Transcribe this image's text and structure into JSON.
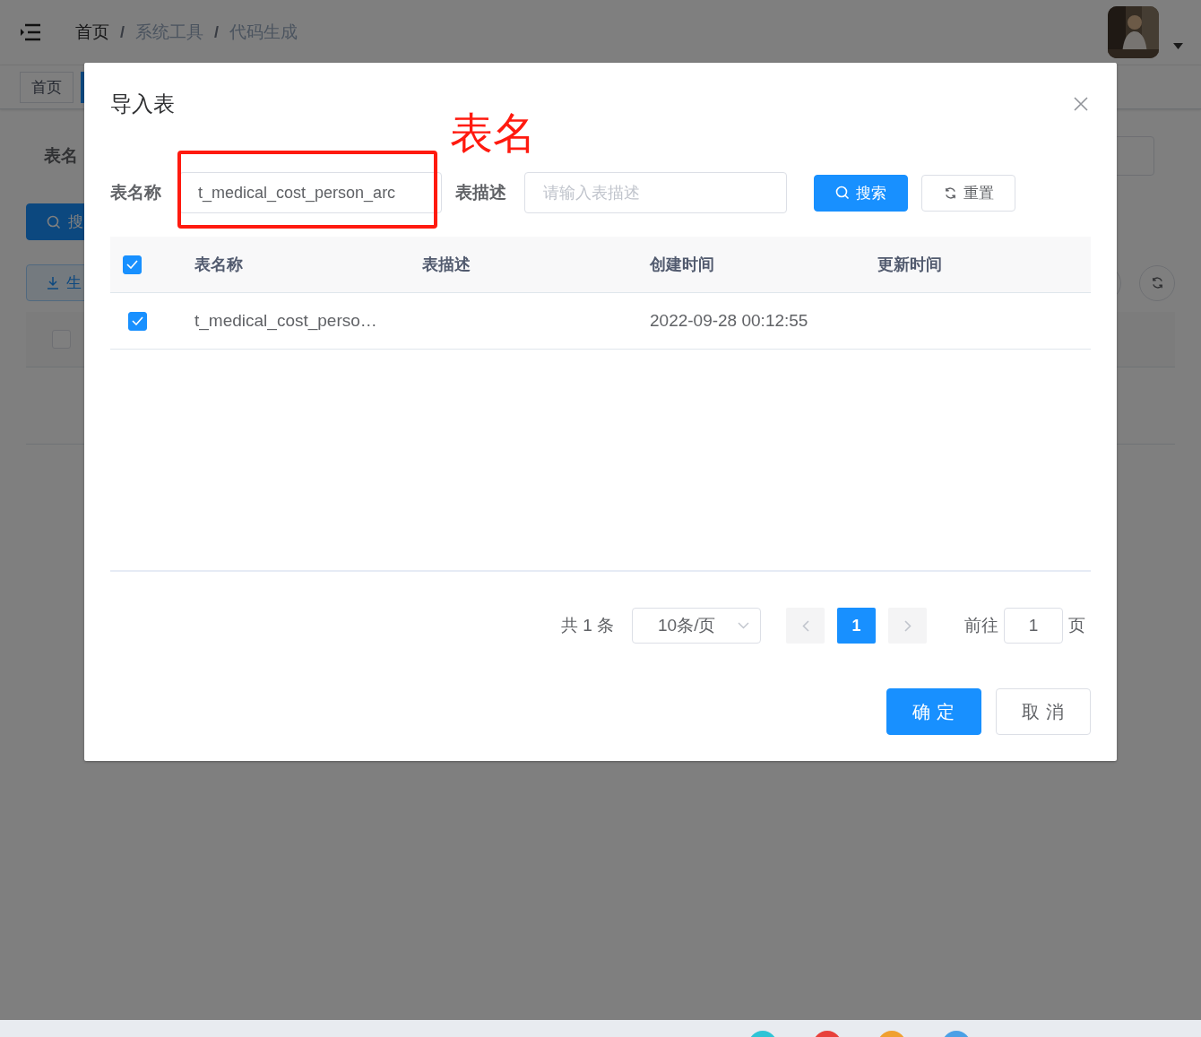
{
  "background_page": {
    "breadcrumb": [
      {
        "label": "首页",
        "current": false
      },
      {
        "separator": "/",
        "label": "系统工具",
        "current": true
      },
      {
        "separator": "/",
        "label": "代码生成",
        "current": true
      }
    ],
    "tabs": [
      {
        "label": "首页",
        "selected": false
      }
    ],
    "form_label": "表名",
    "search_button": "搜",
    "generate_button": "生",
    "header_checked": false
  },
  "dialog": {
    "title": "导入表",
    "filters": [
      {
        "label": "表名称",
        "value": "t_medical_cost_person_arc"
      },
      {
        "label": "表描述",
        "placeholder": "请输入表描述"
      }
    ],
    "search_button": "搜索",
    "reset_button": "重置",
    "table": {
      "all_checked": true,
      "columns": [
        "表名称",
        "表描述",
        "创建时间",
        "更新时间"
      ],
      "rows": [
        {
          "checked": true,
          "table_name": "t_medical_cost_perso…",
          "created": "2022-09-28 00:12:55"
        }
      ]
    },
    "pagination": {
      "total": "共 1 条",
      "page_size": "10条/页",
      "pages": [
        {
          "label": "1",
          "selected": true
        }
      ],
      "goto_label": "前往",
      "goto_value": "1",
      "page_suffix": "页"
    },
    "footer_buttons": [
      {
        "label": "确 定",
        "kind": "primary"
      },
      {
        "label": "取 消",
        "kind": "default"
      }
    ]
  },
  "annotation": {
    "label": "表名"
  }
}
